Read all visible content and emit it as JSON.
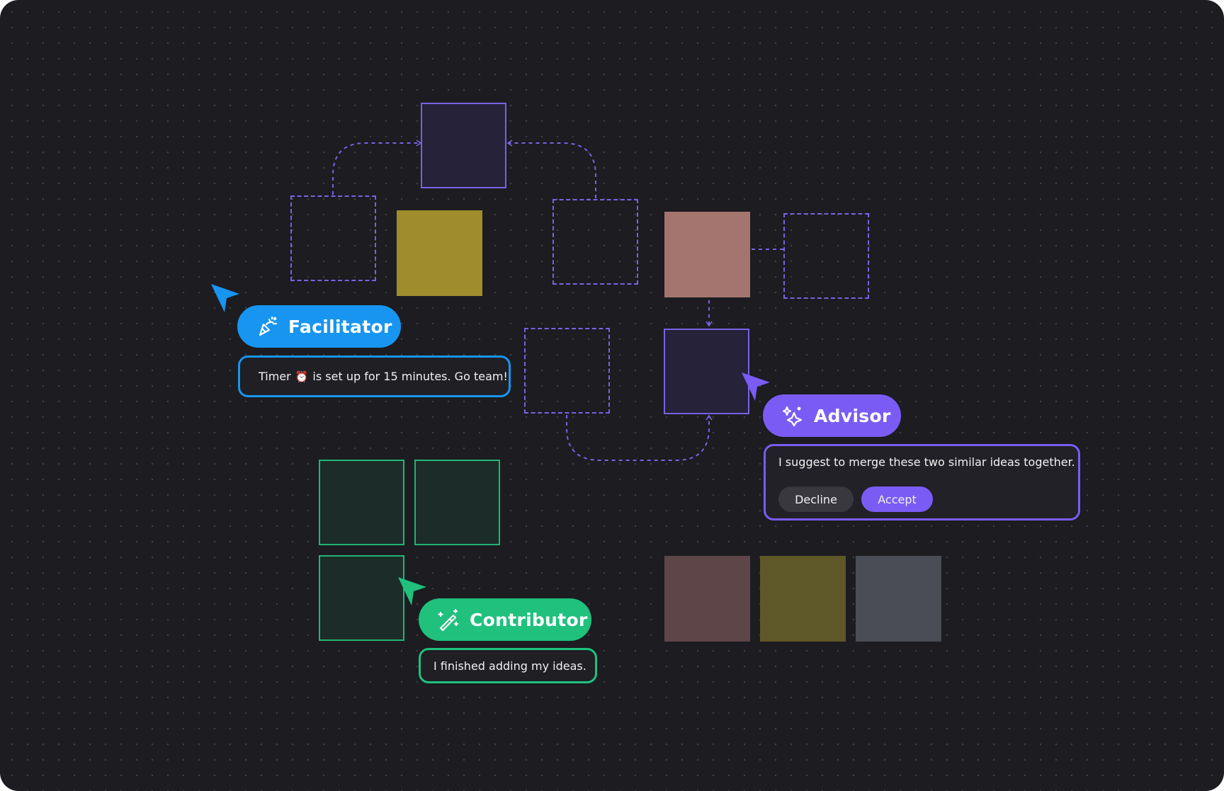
{
  "roles": {
    "facilitator": {
      "label": "Facilitator",
      "color": "#1795f0",
      "icon": "party-popper-icon"
    },
    "advisor": {
      "label": "Advisor",
      "color": "#7a5cf5",
      "icon": "sparkle-icon"
    },
    "contributor": {
      "label": "Contributor",
      "color": "#1fc17d",
      "icon": "magic-wand-icon"
    }
  },
  "messages": {
    "facilitator": {
      "before": "Timer",
      "emoji": "⏰",
      "after": "is set up for 15 minutes. Go team!"
    },
    "advisor": {
      "text": "I suggest to merge these two similar ideas together."
    },
    "contributor": {
      "text": "I finished adding my ideas."
    }
  },
  "actions": {
    "decline": "Decline",
    "accept": "Accept"
  },
  "colors": {
    "background": "#1c1c21",
    "connector": "#7a62e3",
    "sticky_yellow": "#9e8c2d",
    "sticky_rose": "#a4756f",
    "sticky_dark_rose": "#5e4548",
    "sticky_olive": "#5f5828",
    "sticky_gray": "#4a4d55"
  }
}
